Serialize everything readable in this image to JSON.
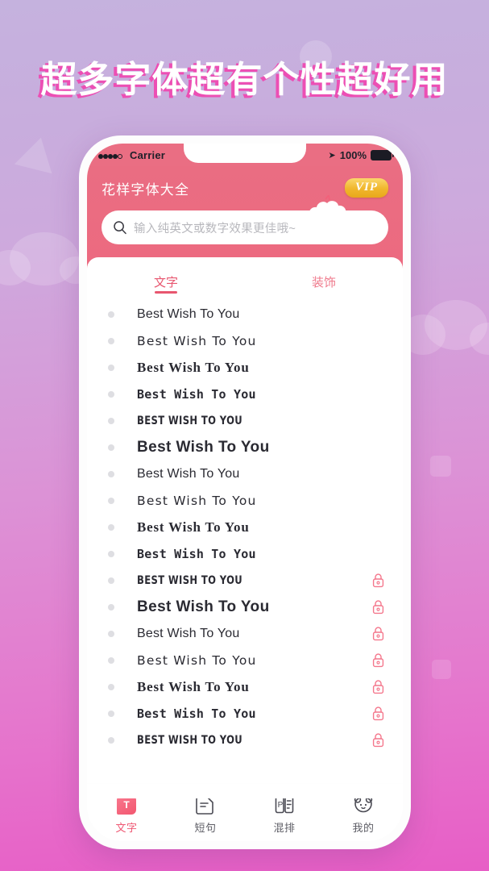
{
  "headline": "超多字体超有个性超好用",
  "colors": {
    "bg_top": "#c5b2de",
    "bg_bottom": "#e75ec6",
    "header_pink": "#ea6d82",
    "accent_pink": "#e8566f",
    "vip_gold": "#f0b62c",
    "lock_pink": "#f4778c"
  },
  "statusbar": {
    "carrier": "Carrier",
    "battery_percent": "100%",
    "location_icon": "location-arrow-icon",
    "signal_icon": "signal-dots-icon",
    "battery_icon": "battery-full-icon"
  },
  "header": {
    "title": "花样字体大全",
    "vip_label": "VIP",
    "mascot_icon": "cloud-sheep-mascot-icon"
  },
  "search": {
    "placeholder": "输入纯英文或数字效果更佳哦~",
    "icon": "search-icon",
    "value": ""
  },
  "tabs": [
    {
      "label": "文字",
      "active": true
    },
    {
      "label": "装饰",
      "active": false
    }
  ],
  "list": {
    "sample_text": "Best Wish To You",
    "rows": [
      {
        "text": "Best Wish To You",
        "style": "f-sans",
        "locked": false
      },
      {
        "text": "Best Wish To You",
        "style": "f-round",
        "locked": false
      },
      {
        "text": "Best Wish To You",
        "style": "f-serif",
        "locked": false
      },
      {
        "text": "Best Wish To You",
        "style": "f-mono",
        "locked": false
      },
      {
        "text": "BEST WISH TO YOU",
        "style": "f-caps",
        "locked": false
      },
      {
        "text": "Best Wish To You",
        "style": "f-heavy",
        "locked": false
      },
      {
        "text": "Best Wish To You",
        "style": "f-sans",
        "locked": false
      },
      {
        "text": "Best Wish To You",
        "style": "f-round",
        "locked": false
      },
      {
        "text": "Best Wish To You",
        "style": "f-serif",
        "locked": false
      },
      {
        "text": "Best Wish To You",
        "style": "f-mono",
        "locked": false
      },
      {
        "text": "BEST WISH TO YOU",
        "style": "f-caps",
        "locked": true
      },
      {
        "text": "Best Wish To You",
        "style": "f-heavy",
        "locked": true
      },
      {
        "text": "Best Wish To You",
        "style": "f-sans",
        "locked": true
      },
      {
        "text": "Best Wish To You",
        "style": "f-round",
        "locked": true
      },
      {
        "text": "Best Wish To You",
        "style": "f-serif",
        "locked": true
      },
      {
        "text": "Best Wish To You",
        "style": "f-mono",
        "locked": true
      },
      {
        "text": "BEST WISH TO YOU",
        "style": "f-caps",
        "locked": true
      }
    ],
    "lock_icon": "lock-icon",
    "bullet_icon": "bullet-dot-icon"
  },
  "bottomnav": [
    {
      "label": "文字",
      "icon": "text-t-icon",
      "active": true
    },
    {
      "label": "短句",
      "icon": "short-phrase-icon",
      "active": false
    },
    {
      "label": "混排",
      "icon": "mixed-layout-icon",
      "active": false
    },
    {
      "label": "我的",
      "icon": "bear-profile-icon",
      "active": false
    }
  ]
}
